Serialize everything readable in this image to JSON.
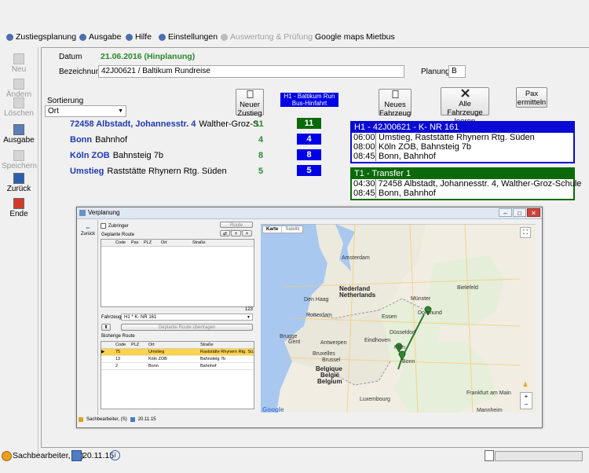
{
  "menu": [
    {
      "label": "Zustiegsplanung",
      "icon": "gear-icon",
      "enabled": true
    },
    {
      "label": "Ausgabe",
      "icon": "printer-icon",
      "enabled": true
    },
    {
      "label": "Hilfe",
      "icon": "help-icon",
      "enabled": true
    },
    {
      "label": "Einstellungen",
      "icon": "settings-icon",
      "enabled": true
    },
    {
      "label": "Auswertung & Prüfung",
      "icon": "chart-icon",
      "enabled": false
    },
    {
      "label": "Google maps",
      "icon": "",
      "enabled": true
    },
    {
      "label": "Mietbus",
      "icon": "",
      "enabled": true
    }
  ],
  "toolbar": [
    {
      "label": "Neu",
      "icon": "new-document-icon",
      "enabled": false
    },
    {
      "label": "Ändern",
      "icon": "edit-icon",
      "enabled": false
    },
    {
      "label": "Löschen",
      "icon": "delete-icon",
      "enabled": false
    },
    {
      "label": "Ausgabe",
      "icon": "printer-icon",
      "enabled": true
    },
    {
      "label": "Speichern",
      "icon": "save-icon",
      "enabled": false
    },
    {
      "label": "Zurück",
      "icon": "back-arrow-icon",
      "enabled": true
    },
    {
      "label": "Ende",
      "icon": "exit-icon",
      "enabled": true
    }
  ],
  "form": {
    "datum_label": "Datum",
    "datum_value": "21.06.2016 (Hinplanung)",
    "bezeichnung_label": "Bezeichnung",
    "bezeichnung_value": "42J00621 / Baltikum Rundreise",
    "planung_label": "Planung",
    "planung_value": "B",
    "sortierung_label": "Sortierung",
    "sortierung_value": "Ort"
  },
  "buttons": {
    "neuer_zustieg": "Neuer Zustieg",
    "neues_fahrzeug": "Neues Fahrzeug",
    "alle_leeren": "Alle Fahrzeuge leeren",
    "pax_ermitteln": "Pax ermitteln"
  },
  "bus_chip": {
    "line1": "H1 - Baltikum Run",
    "line2": "Bus-Hinfahrt"
  },
  "stops": [
    {
      "bold": "72458 Albstadt, Johannesstr. 4",
      "rest": "Walther-Groz-S",
      "count": "11",
      "pill": "11",
      "pill_color": "#0a6a0a"
    },
    {
      "bold": "Bonn",
      "rest": "Bahnhof",
      "count": "4",
      "pill": "4",
      "pill_color": "#0000e6"
    },
    {
      "bold": "Köln ZOB",
      "rest": "Bahnsteig 7b",
      "count": "8",
      "pill": "8",
      "pill_color": "#0000e6"
    },
    {
      "bold": "Umstieg",
      "rest": "Raststätte Rhynern Rtg. Süden",
      "count": "5",
      "pill": "5",
      "pill_color": "#0000e6"
    }
  ],
  "vehicles": [
    {
      "title": "H1 - 42J00621 - K- NR 161",
      "color": "#0a0ad6",
      "rows": [
        {
          "time": "06:00",
          "desc": "Umstieg, Raststätte Rhynern Rtg. Süden"
        },
        {
          "time": "08:00",
          "desc": "Köln ZOB, Bahnsteig 7b"
        },
        {
          "time": "08:45",
          "desc": "Bonn, Bahnhof"
        }
      ]
    },
    {
      "title": "T1 - Transfer 1",
      "color": "#0a6a0a",
      "rows": [
        {
          "time": "04:30",
          "desc": "72458 Albstadt, Johannesstr. 4, Walther-Groz-Schule"
        },
        {
          "time": "08:45",
          "desc": "Bonn, Bahnhof"
        }
      ]
    }
  ],
  "inner": {
    "title": "Verplanung",
    "zurueck": "Zurück",
    "zubringer": "Zubringer",
    "route_btn": "Route optimieren",
    "geplante_route": "Geplante Route",
    "grid_cols": [
      "Code",
      "Pax",
      "PLZ",
      "Ort",
      "Straße"
    ],
    "count_label": "123",
    "fahrzeug_label": "Fahrzeug",
    "fahrzeug_value": "H1 * K- NR 161",
    "uebertragen_btn": "Geplante Route übertragen",
    "bisherige_route": "Bisherige Route",
    "grid2_cols": [
      "Code",
      "PLZ",
      "Ort",
      "Straße"
    ],
    "grid2_rows": [
      {
        "code": "75",
        "plz": "",
        "ort": "Umstieg",
        "strasse": "Raststätte Rhynern Rtg. Sü...",
        "selected": true
      },
      {
        "code": "13",
        "plz": "",
        "ort": "Köln ZOB",
        "strasse": "Bahnsteig 7b",
        "selected": false
      },
      {
        "code": "2",
        "plz": "",
        "ort": "Bonn",
        "strasse": "Bahnhof",
        "selected": false
      }
    ],
    "map_tabs": [
      "Karte",
      "Satellit"
    ],
    "status_user": "Sachbearbeiter, (S)",
    "status_date": "20.11.15",
    "map_labels": [
      {
        "text": "Nederland",
        "cls": "big"
      },
      {
        "text": "Netherlands",
        "cls": "big"
      },
      {
        "text": "Belgique",
        "cls": "big"
      },
      {
        "text": "België",
        "cls": "big"
      },
      {
        "text": "Belgium",
        "cls": "big"
      },
      {
        "text": "Amsterdam",
        "cls": ""
      },
      {
        "text": "Den Haag",
        "cls": ""
      },
      {
        "text": "Rotterdam",
        "cls": ""
      },
      {
        "text": "Antwerpen",
        "cls": ""
      },
      {
        "text": "Bruxelles",
        "cls": ""
      },
      {
        "text": "Brussel",
        "cls": ""
      },
      {
        "text": "Gent",
        "cls": ""
      },
      {
        "text": "Brugge",
        "cls": ""
      },
      {
        "text": "Eindhoven",
        "cls": ""
      },
      {
        "text": "Münster",
        "cls": ""
      },
      {
        "text": "Bielefeld",
        "cls": ""
      },
      {
        "text": "Dortmund",
        "cls": ""
      },
      {
        "text": "Essen",
        "cls": ""
      },
      {
        "text": "Düsseldorf",
        "cls": ""
      },
      {
        "text": "Köln",
        "cls": ""
      },
      {
        "text": "Bonn",
        "cls": ""
      },
      {
        "text": "Frankfurt am Main",
        "cls": ""
      },
      {
        "text": "Luxembourg",
        "cls": ""
      },
      {
        "text": "Mannheim",
        "cls": ""
      },
      {
        "text": "Google",
        "cls": "big"
      }
    ]
  },
  "status": {
    "user": "Sachbearbeiter, (S)",
    "date": "20.11.15"
  }
}
